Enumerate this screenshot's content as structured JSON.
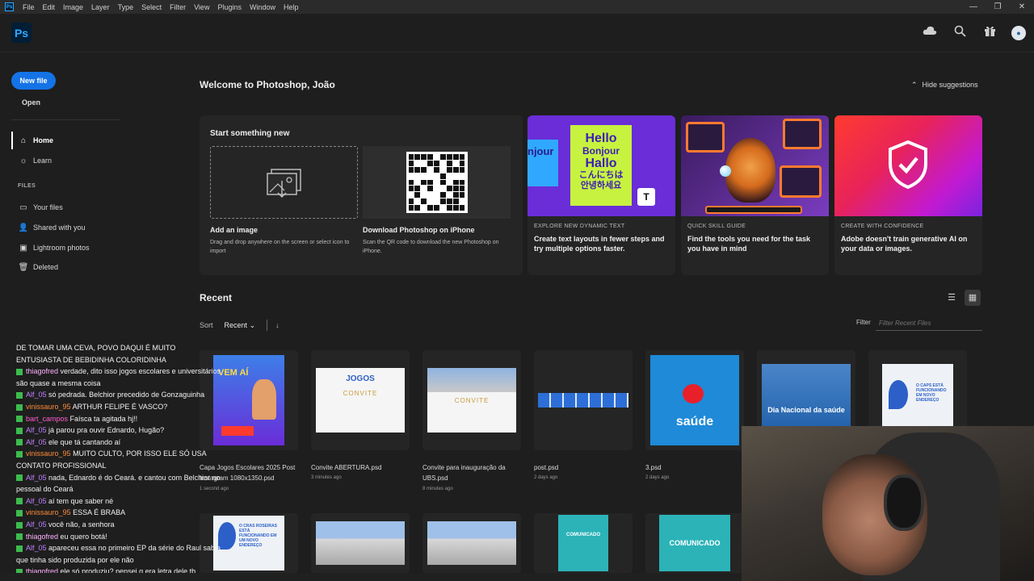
{
  "menubar": {
    "app_icon": "Ps",
    "items": [
      "File",
      "Edit",
      "Image",
      "Layer",
      "Type",
      "Select",
      "Filter",
      "View",
      "Plugins",
      "Window",
      "Help"
    ],
    "window_controls": [
      "—",
      "❐",
      "✕"
    ]
  },
  "header": {
    "logo": "Ps",
    "icons": [
      "cloud-icon",
      "search-icon",
      "gift-icon",
      "avatar"
    ]
  },
  "sidebar": {
    "new_file": "New file",
    "open": "Open",
    "nav": [
      {
        "label": "Home",
        "icon": "home-icon"
      },
      {
        "label": "Learn",
        "icon": "lightbulb-icon"
      }
    ],
    "files_heading": "FILES",
    "files": [
      {
        "label": "Your files",
        "icon": "folder-icon"
      },
      {
        "label": "Shared with you",
        "icon": "user-icon"
      },
      {
        "label": "Lightroom photos",
        "icon": "lightroom-icon"
      },
      {
        "label": "Deleted",
        "icon": "trash-icon"
      }
    ]
  },
  "main": {
    "welcome": "Welcome to Photoshop, João",
    "hide_suggestions": "Hide suggestions",
    "start": {
      "title": "Start something new",
      "add_image_title": "Add an image",
      "add_image_desc": "Drag and drop anywhere on the screen or select icon to import",
      "download_title": "Download Photoshop on iPhone",
      "download_desc": "Scan the QR code to download the new Photoshop on iPhone."
    },
    "cards": [
      {
        "eyebrow": "EXPLORE NEW DYNAMIC TEXT",
        "title": "Create text layouts in fewer steps and try multiple options faster.",
        "art_lines": [
          "Hello",
          "Bonjour",
          "Hallo",
          "こんにちは",
          "안녕하세요"
        ],
        "side_text": "njour"
      },
      {
        "eyebrow": "QUICK SKILL GUIDE",
        "title": "Find the tools you need for the task you have in mind"
      },
      {
        "eyebrow": "CREATE WITH CONFIDENCE",
        "title": "Adobe doesn't train generative AI on your data or images."
      }
    ],
    "recent": {
      "heading": "Recent",
      "sort_label": "Sort",
      "sort_value": "Recent",
      "filter_label": "Filter",
      "filter_placeholder": "Filter Recent Files",
      "files": [
        {
          "name": "Capa Jogos Escolares 2025 Post Instagram 1080x1350.psd",
          "date": "1 second ago",
          "thumb_text": "VEM AÍ"
        },
        {
          "name": "Convite ABERTURA.psd",
          "date": "3 minutes ago",
          "thumb_text": "CONVITE"
        },
        {
          "name": "Convite para inauguração da UBS.psd",
          "date": "8 minutes ago",
          "thumb_text": "CONVITE"
        },
        {
          "name": "post.psd",
          "date": "2 days ago",
          "thumb_text": ""
        },
        {
          "name": "3.psd",
          "date": "2 days ago",
          "thumb_text": "saúde"
        },
        {
          "name": "",
          "date": "",
          "thumb_text": "Dia Nacional da saúde"
        },
        {
          "name": "",
          "date": "",
          "thumb_text": "O CAPS ESTÁ FUNCIONANDO EM NOVO ENDEREÇO"
        }
      ],
      "second_row": [
        "O CRAS ROSEIRAS ESTÁ FUNCIONANDO EM UM NOVO ENDEREÇO",
        "",
        "",
        "COMUNICADO",
        "COMUNICADO"
      ]
    }
  },
  "chat": [
    {
      "user": "",
      "text": "DE TOMAR UMA CEVA, POVO DAQUI É MUITO ENTUSIASTA DE BEBIDINHA COLORIDINHA",
      "color": "#ffffff"
    },
    {
      "user": "thiagofred",
      "text": "verdade, dito isso jogos escolares e universitários são quase a mesma coisa",
      "color": "#ffb3ff"
    },
    {
      "user": "Alf_05",
      "text": "só pedrada. Belchior precedido de Gonzaguinha",
      "color": "#c080ff"
    },
    {
      "user": "vinissauro_95",
      "text": "ARTHUR FELIPE É VASCO?",
      "color": "#ff8c3b"
    },
    {
      "user": "bart_campos",
      "text": "Faísca ta agitada hj!!",
      "color": "#ff5cd0"
    },
    {
      "user": "Alf_05",
      "text": "já parou pra ouvir Ednardo, Hugão?",
      "color": "#c080ff"
    },
    {
      "user": "Alf_05",
      "text": "ele que tá cantando aí",
      "color": "#c080ff"
    },
    {
      "user": "vinissauro_95",
      "text": "MUITO CULTO, POR ISSO ELE SÓ USA CONTATO PROFISSIONAL",
      "color": "#ff8c3b"
    },
    {
      "user": "Alf_05",
      "text": "nada, Ednardo é do Ceará. e cantou com Belchior no pessoal do Ceará",
      "color": "#c080ff"
    },
    {
      "user": "Alf_05",
      "text": "aí tem que saber né",
      "color": "#c080ff"
    },
    {
      "user": "vinissauro_95",
      "text": "ESSA É BRABA",
      "color": "#ff8c3b"
    },
    {
      "user": "Alf_05",
      "text": "você não, a senhora",
      "color": "#c080ff"
    },
    {
      "user": "thiagofred",
      "text": "eu quero botá!",
      "color": "#ffb3ff"
    },
    {
      "user": "Alf_05",
      "text": "apareceu essa no primeiro EP da série do Raul sabia que tinha sido produzida por ele não",
      "color": "#c080ff"
    },
    {
      "user": "thiagofred",
      "text": "ele só produziu? pensei q era letra dele tb",
      "color": "#ffb3ff"
    }
  ],
  "colors": {
    "accent": "#1473e6",
    "ps_blue": "#31a8ff",
    "chat_badge": "#3dbb4e"
  }
}
